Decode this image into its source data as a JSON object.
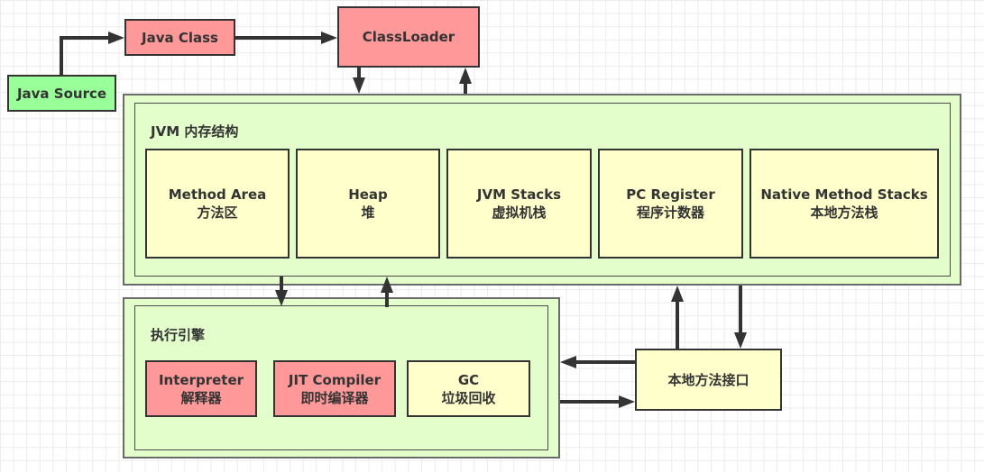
{
  "nodes": {
    "java_source": "Java Source",
    "java_class": "Java Class",
    "class_loader": "ClassLoader",
    "native_interface": "本地方法接口"
  },
  "jvm_memory": {
    "title": "JVM 内存结构",
    "areas": [
      {
        "en": "Method Area",
        "zh": "方法区"
      },
      {
        "en": "Heap",
        "zh": "堆"
      },
      {
        "en": "JVM Stacks",
        "zh": "虚拟机栈"
      },
      {
        "en": "PC Register",
        "zh": "程序计数器"
      },
      {
        "en": "Native Method Stacks",
        "zh": "本地方法栈"
      }
    ]
  },
  "execution_engine": {
    "title": "执行引擎",
    "components": [
      {
        "en": "Interpreter",
        "zh": "解释器"
      },
      {
        "en": "JIT Compiler",
        "zh": "即时编译器"
      },
      {
        "en": "GC",
        "zh": "垃圾回收"
      }
    ]
  },
  "colors": {
    "source_fill": "#99ff99",
    "class_fill": "#ff9999",
    "area_fill": "#ffffcc",
    "container_fill": "#e3fecb",
    "stroke": "#333333"
  }
}
